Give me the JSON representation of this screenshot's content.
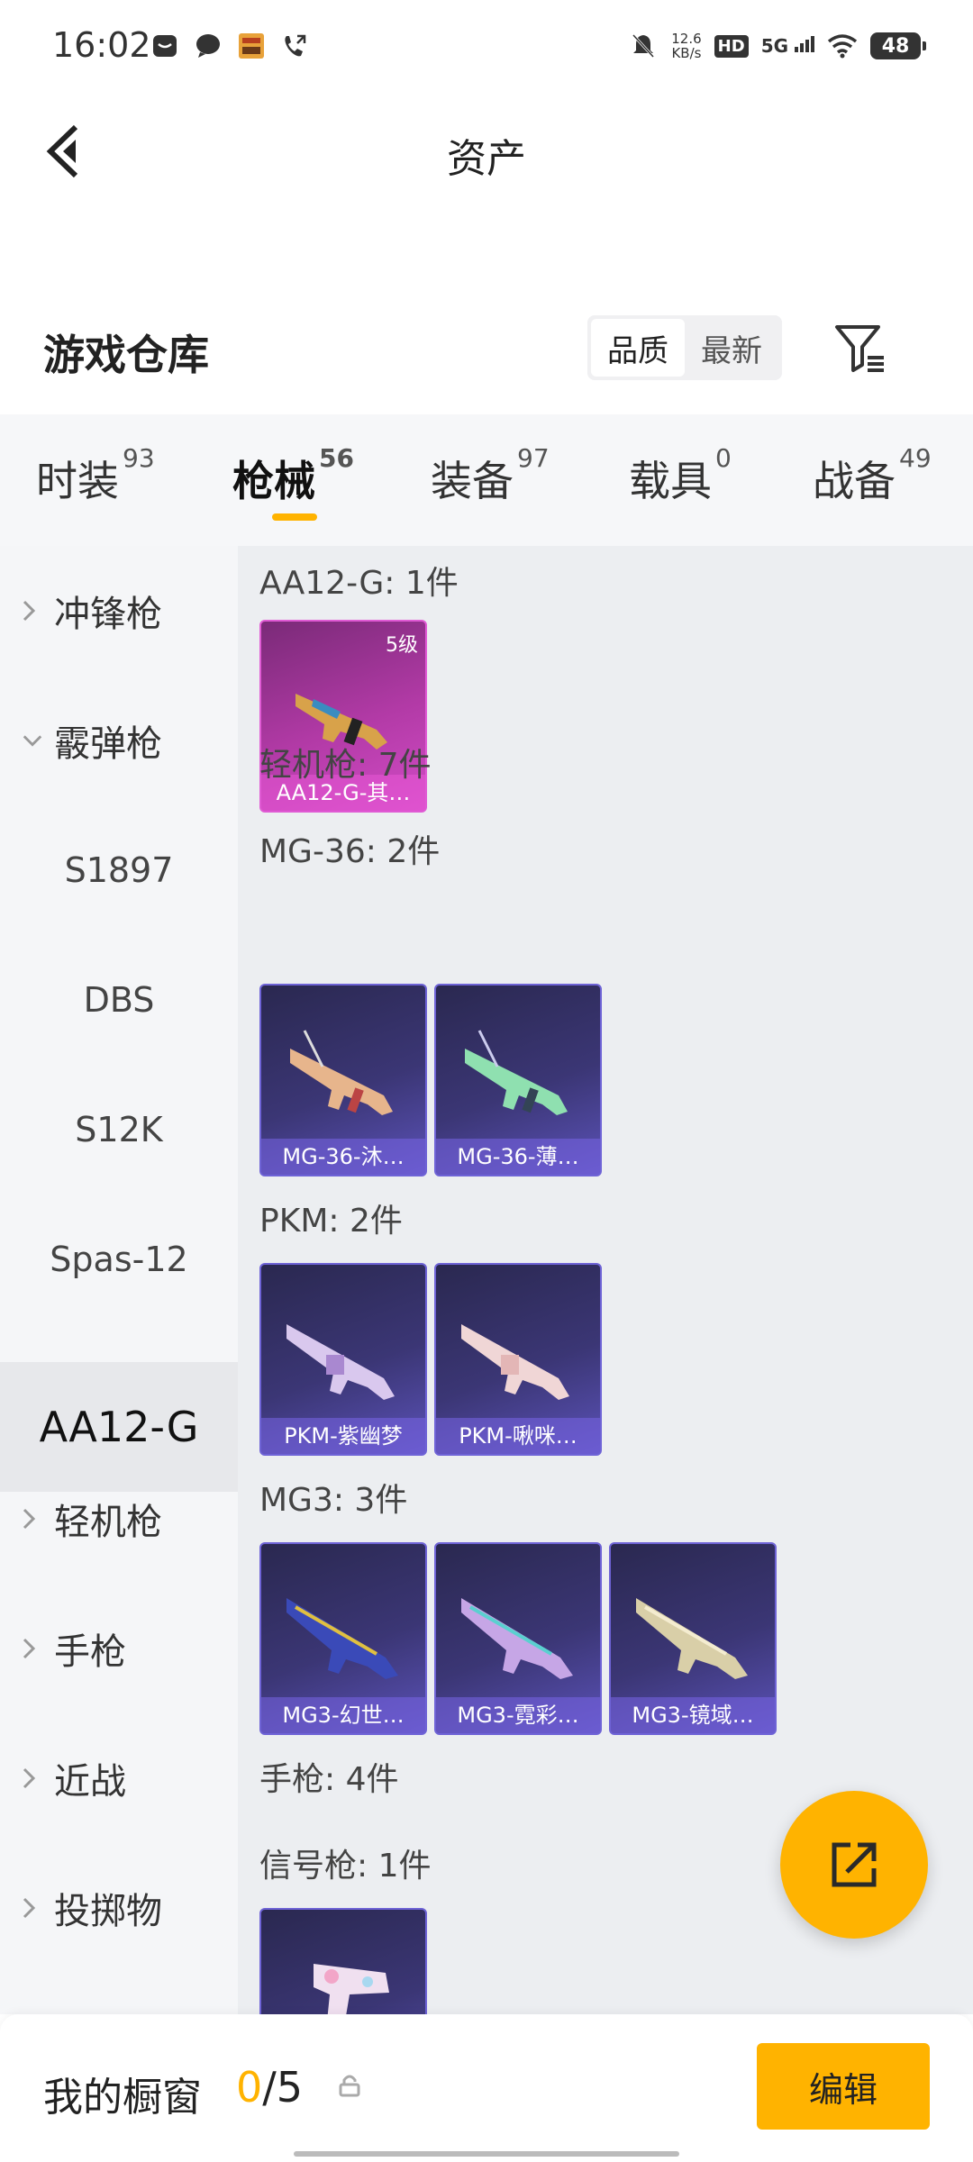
{
  "status_bar": {
    "time": "16:02",
    "net_speed_value": "12.6",
    "net_speed_unit": "KB/s",
    "hd": "HD",
    "network": "5G",
    "battery": "48"
  },
  "header": {
    "title": "资产"
  },
  "warehouse": {
    "title": "游戏仓库",
    "sort_options": [
      "品质",
      "最新"
    ],
    "active_sort": "品质"
  },
  "tabs": [
    {
      "label": "时装",
      "count": "93"
    },
    {
      "label": "枪械",
      "count": "56"
    },
    {
      "label": "装备",
      "count": "97"
    },
    {
      "label": "载具",
      "count": "0"
    },
    {
      "label": "战备",
      "count": "49"
    }
  ],
  "active_tab": "枪械",
  "sidebar": {
    "items": [
      {
        "label": "冲锋枪",
        "type": "collapsed"
      },
      {
        "label": "霰弹枪",
        "type": "expanded"
      },
      {
        "label": "S1897",
        "type": "sub"
      },
      {
        "label": "DBS",
        "type": "sub"
      },
      {
        "label": "S12K",
        "type": "sub"
      },
      {
        "label": "Spas-12",
        "type": "sub"
      },
      {
        "label": "AA12-G",
        "type": "active"
      },
      {
        "label": "轻机枪",
        "type": "collapsed"
      },
      {
        "label": "手枪",
        "type": "collapsed"
      },
      {
        "label": "近战",
        "type": "collapsed"
      },
      {
        "label": "投掷物",
        "type": "collapsed"
      }
    ]
  },
  "content": {
    "groups": [
      {
        "label": "AA12-G: 1件"
      },
      {
        "label": "轻机枪: 7件"
      },
      {
        "label": "MG-36: 2件"
      },
      {
        "label": "PKM: 2件"
      },
      {
        "label": "MG3: 3件"
      },
      {
        "label": "手枪: 4件"
      },
      {
        "label": "信号枪: 1件"
      }
    ],
    "cards": [
      {
        "name": "AA12-G-其…",
        "level": "5级",
        "rarity": "pink"
      },
      {
        "name": "MG-36-沐…",
        "rarity": "purple"
      },
      {
        "name": "MG-36-薄…",
        "rarity": "purple"
      },
      {
        "name": "PKM-紫幽梦",
        "rarity": "purple"
      },
      {
        "name": "PKM-啾咪…",
        "rarity": "purple"
      },
      {
        "name": "MG3-幻世…",
        "rarity": "purple"
      },
      {
        "name": "MG3-霓彩…",
        "rarity": "purple"
      },
      {
        "name": "MG3-镜域…",
        "rarity": "purple"
      },
      {
        "name": "",
        "rarity": "purple"
      }
    ]
  },
  "bottom": {
    "showcase_label": "我的橱窗",
    "showcase_current": "0",
    "showcase_total": "/5",
    "edit_label": "编辑"
  },
  "colors": {
    "accent": "#ffb300",
    "card_purple": "#3b3675",
    "card_pink": "#b23aa6"
  },
  "icons": {
    "back": "back-arrow-icon",
    "filter": "filter-icon",
    "share": "share-icon",
    "lock": "lock-icon"
  }
}
